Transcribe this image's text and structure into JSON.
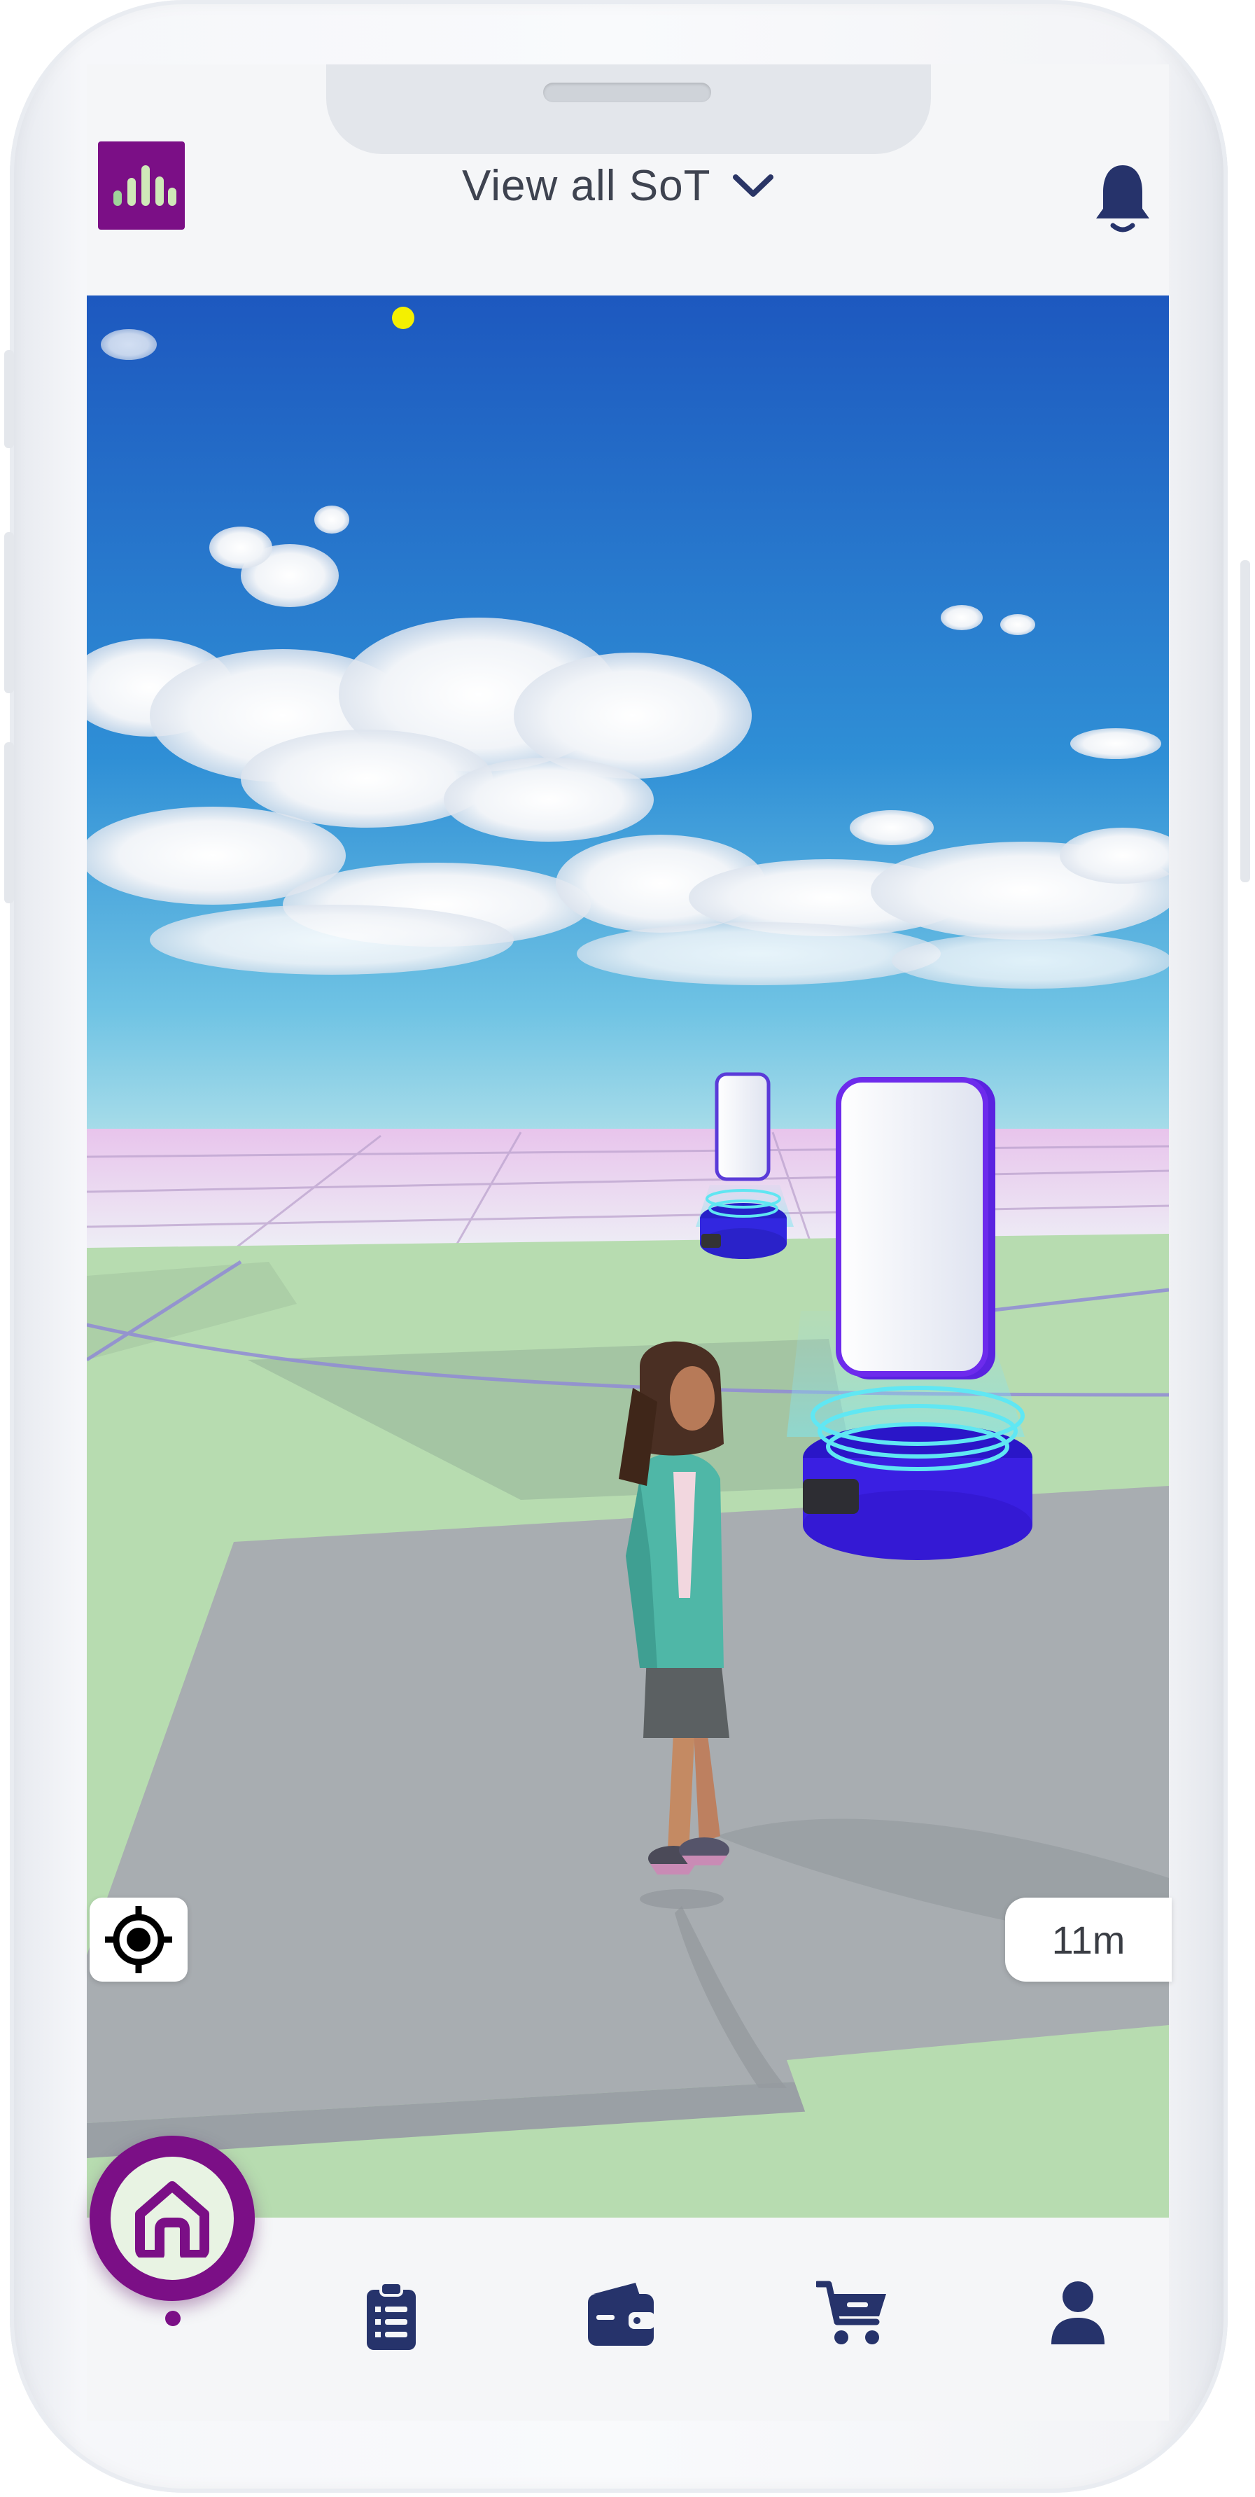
{
  "header": {
    "selector_label": "View all SoT",
    "logo_icon": "app-logo-icon",
    "notification_icon": "bell-icon"
  },
  "map": {
    "distance_label": "11m",
    "locate_icon": "crosshair-icon"
  },
  "bottom_nav": {
    "items": [
      {
        "icon": "home-icon",
        "active": true
      },
      {
        "icon": "clipboard-list-icon",
        "active": false
      },
      {
        "icon": "wallet-icon",
        "active": false
      },
      {
        "icon": "cart-icon",
        "active": false
      },
      {
        "icon": "user-icon",
        "active": false
      }
    ]
  },
  "colors": {
    "brand_purple": "#7b0f86",
    "nav_icon": "#26336b",
    "sky_top": "#1d5cc3",
    "ground_green": "#b7dcb0"
  }
}
